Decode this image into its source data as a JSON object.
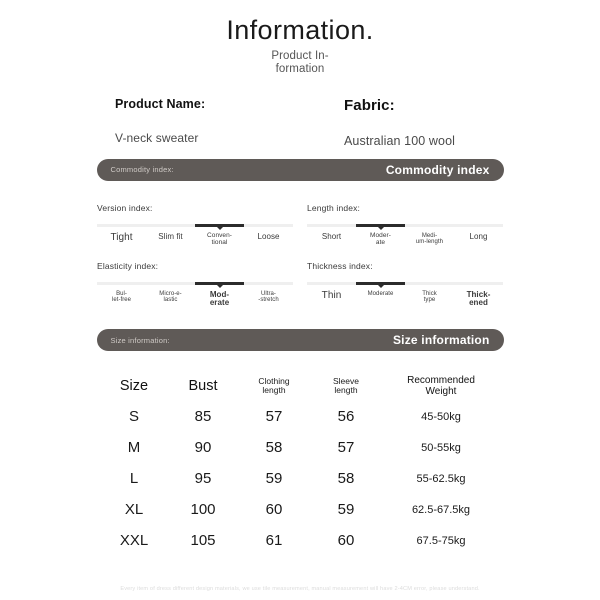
{
  "header": {
    "title": "Information.",
    "subtitle_line1": "Product In-",
    "subtitle_line2": "formation"
  },
  "product": {
    "name_label": "Product Name:",
    "name_value": "V-neck sweater",
    "fabric_label": "Fabric:",
    "fabric_value": "Australian 100 wool"
  },
  "commodity_banner": {
    "small_label": "Commodity index:",
    "big_label": "Commodity index"
  },
  "size_banner": {
    "small_label": "Size information:",
    "big_label": "Size information"
  },
  "scales": [
    {
      "title": "Version index:",
      "active": 2,
      "options": [
        {
          "line1": "Tight",
          "line2": "",
          "size": "sz-lg",
          "bold": false
        },
        {
          "line1": "Slim fit",
          "line2": "",
          "size": "sz-md",
          "bold": false
        },
        {
          "line1": "Conven-",
          "line2": "tional",
          "size": "sz-sm",
          "bold": false
        },
        {
          "line1": "Loose",
          "line2": "",
          "size": "sz-md",
          "bold": false
        }
      ]
    },
    {
      "title": "Length index:",
      "active": 1,
      "options": [
        {
          "line1": "Short",
          "line2": "",
          "size": "sz-md",
          "bold": false
        },
        {
          "line1": "Moder-",
          "line2": "ate",
          "size": "sz-sm",
          "bold": false
        },
        {
          "line1": "Medi-",
          "line2": "um-length",
          "size": "sz-xs",
          "bold": false
        },
        {
          "line1": "Long",
          "line2": "",
          "size": "sz-md",
          "bold": false
        }
      ]
    },
    {
      "title": "Elasticity index:",
      "active": 2,
      "options": [
        {
          "line1": "Bul-",
          "line2": "let-free",
          "size": "sz-xs",
          "bold": false
        },
        {
          "line1": "Micro-e-",
          "line2": "lastic",
          "size": "sz-xs",
          "bold": false
        },
        {
          "line1": "Mod-",
          "line2": "erate",
          "size": "sz-md",
          "bold": true
        },
        {
          "line1": "Ultra-",
          "line2": "-stretch",
          "size": "sz-xs",
          "bold": false
        }
      ]
    },
    {
      "title": "Thickness index:",
      "active": 1,
      "options": [
        {
          "line1": "Thin",
          "line2": "",
          "size": "sz-lg",
          "bold": false
        },
        {
          "line1": "Moderate",
          "line2": "",
          "size": "sz-xs",
          "bold": false
        },
        {
          "line1": "Thick",
          "line2": "type",
          "size": "sz-xs",
          "bold": false
        },
        {
          "line1": "Thick-",
          "line2": "ened",
          "size": "sz-md",
          "bold": true
        }
      ]
    }
  ],
  "size_table": {
    "headers": [
      {
        "line1": "Size",
        "line2": ""
      },
      {
        "line1": "Bust",
        "line2": ""
      },
      {
        "line1": "Clothing",
        "line2": "length"
      },
      {
        "line1": "Sleeve",
        "line2": "length"
      },
      {
        "line1": "Recommended",
        "line2": "Weight"
      }
    ],
    "rows": [
      {
        "size": "S",
        "bust": "85",
        "clothing_length": "57",
        "sleeve_length": "56",
        "weight": "45-50kg"
      },
      {
        "size": "M",
        "bust": "90",
        "clothing_length": "58",
        "sleeve_length": "57",
        "weight": "50-55kg"
      },
      {
        "size": "L",
        "bust": "95",
        "clothing_length": "59",
        "sleeve_length": "58",
        "weight": "55-62.5kg"
      },
      {
        "size": "XL",
        "bust": "100",
        "clothing_length": "60",
        "sleeve_length": "59",
        "weight": "62.5-67.5kg"
      },
      {
        "size": "XXL",
        "bust": "105",
        "clothing_length": "61",
        "sleeve_length": "60",
        "weight": "67.5-75kg"
      }
    ]
  },
  "footer": {
    "disclaimer": "Every item of dress different design materials, we use tile measurement, manual measurement will have 2-4CM error, please understand."
  },
  "colors": {
    "banner_bg": "#5f5a57",
    "active_segment": "#2b2b2b",
    "track": "#efefef"
  }
}
